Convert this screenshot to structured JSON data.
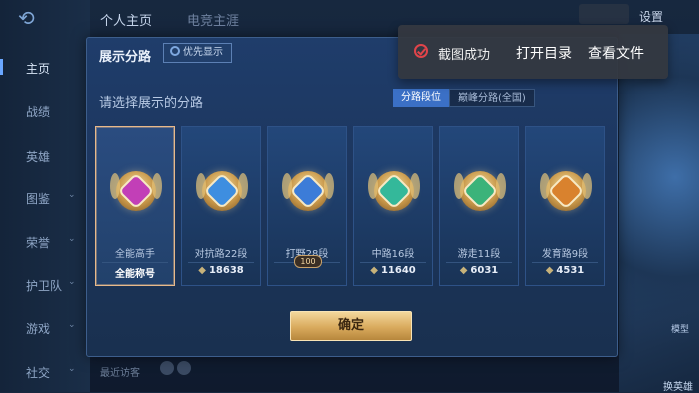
{
  "nav": {
    "items": [
      {
        "label": "主页",
        "chev": ""
      },
      {
        "label": "战绩",
        "chev": ""
      },
      {
        "label": "英雄",
        "chev": ""
      },
      {
        "label": "图鉴",
        "chev": "⌄"
      },
      {
        "label": "荣誉",
        "chev": "⌄"
      },
      {
        "label": "护卫队",
        "chev": "⌄"
      },
      {
        "label": "游戏",
        "chev": "⌄"
      },
      {
        "label": "社交",
        "chev": "⌄"
      }
    ]
  },
  "top": {
    "tab1": "个人主页",
    "tab2": "电竞主涯",
    "settings": "设置"
  },
  "panel": {
    "title": "展示分路",
    "priority_label": "优先显示",
    "subtitle": "请选择展示的分路",
    "seg_on": "分路段位",
    "seg_off": "巅峰分路(全国)",
    "confirm": "确定"
  },
  "cards": [
    {
      "name": "全能高手",
      "stat": "全能称号",
      "has_diamond": false,
      "color": "#c23fb7",
      "selected": true
    },
    {
      "name": "对抗路22段",
      "stat": "18638",
      "has_diamond": true,
      "color": "#3e8ee0",
      "selected": false
    },
    {
      "name": "打野28段",
      "stat": "100",
      "has_diamond": false,
      "color": "#3c7cd8",
      "selected": false,
      "badge": true
    },
    {
      "name": "中路16段",
      "stat": "11640",
      "has_diamond": true,
      "color": "#34b89a",
      "selected": false
    },
    {
      "name": "游走11段",
      "stat": "6031",
      "has_diamond": true,
      "color": "#3bb37a",
      "selected": false
    },
    {
      "name": "发育路9段",
      "stat": "4531",
      "has_diamond": true,
      "color": "#d9822e",
      "selected": false
    }
  ],
  "toast": {
    "message": "截图成功",
    "open_dir": "打开目录",
    "view_file": "查看文件"
  },
  "right": {
    "model_label": "模型",
    "swap_label": "换英雄"
  },
  "bottom": {
    "recent": "最近访客"
  },
  "colors": {
    "accent": "#3b70c6",
    "gold": "#d9aa5d",
    "toast_ok": "#e0444a"
  }
}
